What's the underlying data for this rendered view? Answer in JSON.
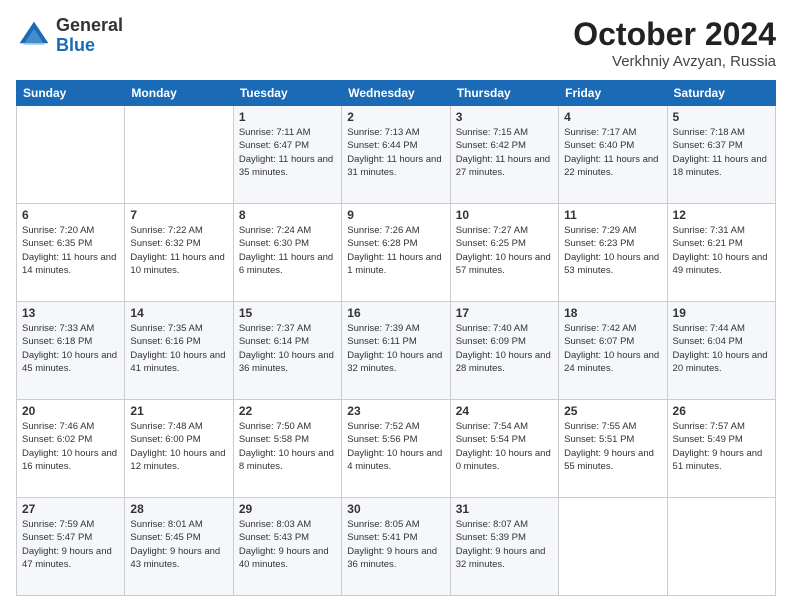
{
  "header": {
    "logo": {
      "general": "General",
      "blue": "Blue"
    },
    "title": "October 2024",
    "location": "Verkhniy Avzyan, Russia"
  },
  "weekdays": [
    "Sunday",
    "Monday",
    "Tuesday",
    "Wednesday",
    "Thursday",
    "Friday",
    "Saturday"
  ],
  "weeks": [
    [
      {
        "day": "",
        "info": ""
      },
      {
        "day": "",
        "info": ""
      },
      {
        "day": "1",
        "info": "Sunrise: 7:11 AM\nSunset: 6:47 PM\nDaylight: 11 hours and 35 minutes."
      },
      {
        "day": "2",
        "info": "Sunrise: 7:13 AM\nSunset: 6:44 PM\nDaylight: 11 hours and 31 minutes."
      },
      {
        "day": "3",
        "info": "Sunrise: 7:15 AM\nSunset: 6:42 PM\nDaylight: 11 hours and 27 minutes."
      },
      {
        "day": "4",
        "info": "Sunrise: 7:17 AM\nSunset: 6:40 PM\nDaylight: 11 hours and 22 minutes."
      },
      {
        "day": "5",
        "info": "Sunrise: 7:18 AM\nSunset: 6:37 PM\nDaylight: 11 hours and 18 minutes."
      }
    ],
    [
      {
        "day": "6",
        "info": "Sunrise: 7:20 AM\nSunset: 6:35 PM\nDaylight: 11 hours and 14 minutes."
      },
      {
        "day": "7",
        "info": "Sunrise: 7:22 AM\nSunset: 6:32 PM\nDaylight: 11 hours and 10 minutes."
      },
      {
        "day": "8",
        "info": "Sunrise: 7:24 AM\nSunset: 6:30 PM\nDaylight: 11 hours and 6 minutes."
      },
      {
        "day": "9",
        "info": "Sunrise: 7:26 AM\nSunset: 6:28 PM\nDaylight: 11 hours and 1 minute."
      },
      {
        "day": "10",
        "info": "Sunrise: 7:27 AM\nSunset: 6:25 PM\nDaylight: 10 hours and 57 minutes."
      },
      {
        "day": "11",
        "info": "Sunrise: 7:29 AM\nSunset: 6:23 PM\nDaylight: 10 hours and 53 minutes."
      },
      {
        "day": "12",
        "info": "Sunrise: 7:31 AM\nSunset: 6:21 PM\nDaylight: 10 hours and 49 minutes."
      }
    ],
    [
      {
        "day": "13",
        "info": "Sunrise: 7:33 AM\nSunset: 6:18 PM\nDaylight: 10 hours and 45 minutes."
      },
      {
        "day": "14",
        "info": "Sunrise: 7:35 AM\nSunset: 6:16 PM\nDaylight: 10 hours and 41 minutes."
      },
      {
        "day": "15",
        "info": "Sunrise: 7:37 AM\nSunset: 6:14 PM\nDaylight: 10 hours and 36 minutes."
      },
      {
        "day": "16",
        "info": "Sunrise: 7:39 AM\nSunset: 6:11 PM\nDaylight: 10 hours and 32 minutes."
      },
      {
        "day": "17",
        "info": "Sunrise: 7:40 AM\nSunset: 6:09 PM\nDaylight: 10 hours and 28 minutes."
      },
      {
        "day": "18",
        "info": "Sunrise: 7:42 AM\nSunset: 6:07 PM\nDaylight: 10 hours and 24 minutes."
      },
      {
        "day": "19",
        "info": "Sunrise: 7:44 AM\nSunset: 6:04 PM\nDaylight: 10 hours and 20 minutes."
      }
    ],
    [
      {
        "day": "20",
        "info": "Sunrise: 7:46 AM\nSunset: 6:02 PM\nDaylight: 10 hours and 16 minutes."
      },
      {
        "day": "21",
        "info": "Sunrise: 7:48 AM\nSunset: 6:00 PM\nDaylight: 10 hours and 12 minutes."
      },
      {
        "day": "22",
        "info": "Sunrise: 7:50 AM\nSunset: 5:58 PM\nDaylight: 10 hours and 8 minutes."
      },
      {
        "day": "23",
        "info": "Sunrise: 7:52 AM\nSunset: 5:56 PM\nDaylight: 10 hours and 4 minutes."
      },
      {
        "day": "24",
        "info": "Sunrise: 7:54 AM\nSunset: 5:54 PM\nDaylight: 10 hours and 0 minutes."
      },
      {
        "day": "25",
        "info": "Sunrise: 7:55 AM\nSunset: 5:51 PM\nDaylight: 9 hours and 55 minutes."
      },
      {
        "day": "26",
        "info": "Sunrise: 7:57 AM\nSunset: 5:49 PM\nDaylight: 9 hours and 51 minutes."
      }
    ],
    [
      {
        "day": "27",
        "info": "Sunrise: 7:59 AM\nSunset: 5:47 PM\nDaylight: 9 hours and 47 minutes."
      },
      {
        "day": "28",
        "info": "Sunrise: 8:01 AM\nSunset: 5:45 PM\nDaylight: 9 hours and 43 minutes."
      },
      {
        "day": "29",
        "info": "Sunrise: 8:03 AM\nSunset: 5:43 PM\nDaylight: 9 hours and 40 minutes."
      },
      {
        "day": "30",
        "info": "Sunrise: 8:05 AM\nSunset: 5:41 PM\nDaylight: 9 hours and 36 minutes."
      },
      {
        "day": "31",
        "info": "Sunrise: 8:07 AM\nSunset: 5:39 PM\nDaylight: 9 hours and 32 minutes."
      },
      {
        "day": "",
        "info": ""
      },
      {
        "day": "",
        "info": ""
      }
    ]
  ]
}
